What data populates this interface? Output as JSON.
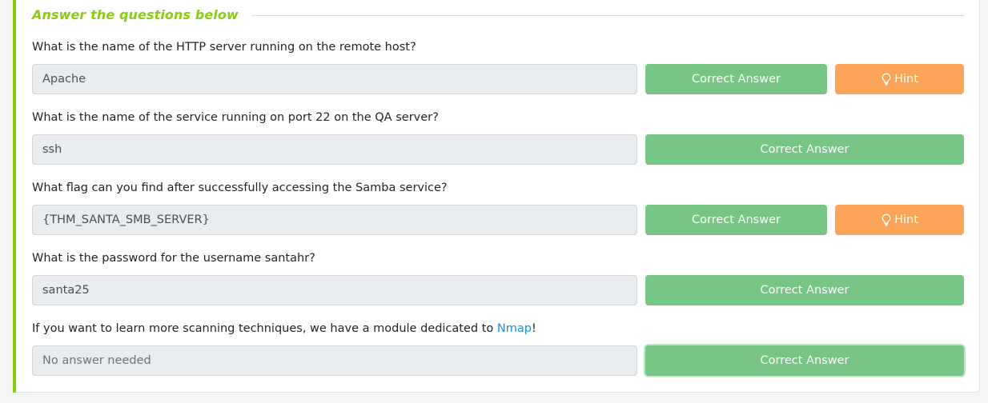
{
  "section": {
    "title": "Answer the questions below"
  },
  "colors": {
    "accent": "#88cc14",
    "correct_button": "#77c686",
    "hint_button": "#fba356",
    "link": "#1a8fdd"
  },
  "questions": [
    {
      "text": "What is the name of the HTTP server running on the remote host?",
      "answer": "Apache",
      "submit_label": "Correct Answer",
      "hint_label": "Hint",
      "hint_icon": "lightbulb-icon"
    },
    {
      "text": "What is the name of the service running on port 22 on the QA server?",
      "answer": "ssh",
      "submit_label": "Correct Answer"
    },
    {
      "text": "What flag can you find after successfully accessing the Samba service?",
      "answer": "{THM_SANTA_SMB_SERVER}",
      "submit_label": "Correct Answer",
      "hint_label": "Hint",
      "hint_icon": "lightbulb-icon"
    },
    {
      "text": "What is the password for the username santahr?",
      "answer": "santa25",
      "submit_label": "Correct Answer"
    },
    {
      "text_before_link": "If you want to learn more scanning techniques, we have a module dedicated to ",
      "link_text": "Nmap",
      "text_after_link": "!",
      "answer_placeholder": "No answer needed",
      "submit_label": "Correct Answer"
    }
  ]
}
